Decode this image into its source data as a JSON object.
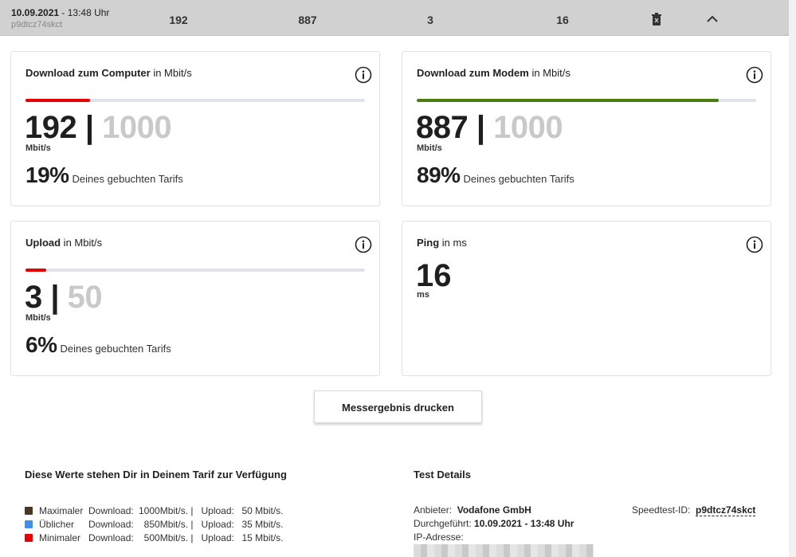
{
  "header": {
    "date": "10.09.2021",
    "time": " - 13:48 Uhr",
    "test_id": "p9dtcz74skct",
    "download_computer": "192",
    "download_modem": "887",
    "upload": "3",
    "ping": "16",
    "icons": [
      "trash-icon",
      "chevron-up-icon"
    ]
  },
  "cards": {
    "download_computer": {
      "title_bold": "Download zum Computer",
      "title_unit": " in Mbit/s",
      "value": "192",
      "separator": " | ",
      "max": "1000",
      "unit": "Mbit/s",
      "percent": "19%",
      "percent_label": "Deines gebuchten Tarifs",
      "progress": 0.19,
      "bar_color": "#e60000"
    },
    "download_modem": {
      "title_bold": "Download zum Modem",
      "title_unit": " in Mbit/s",
      "value": "887",
      "separator": " | ",
      "max": "1000",
      "unit": "Mbit/s",
      "percent": "89%",
      "percent_label": "Deines gebuchten Tarifs",
      "progress": 0.89,
      "bar_color": "#4a7e0f"
    },
    "upload": {
      "title_bold": "Upload",
      "title_unit": " in Mbit/s",
      "value": "3",
      "separator": " | ",
      "max": "50",
      "unit": "Mbit/s",
      "percent": "6%",
      "percent_label": "Deines gebuchten Tarifs",
      "progress": 0.06,
      "bar_color": "#e60000"
    },
    "ping": {
      "title_bold": "Ping",
      "title_unit": " in ms",
      "value": "16",
      "unit": "ms"
    }
  },
  "print_button": "Messergebnis drucken",
  "tarif": {
    "title": "Diese Werte stehen Dir in Deinem Tarif zur Verfügung",
    "rows": [
      {
        "name": "Maximaler",
        "download_label": "Download:",
        "download": "1000Mbit/s. |",
        "upload_label": "Upload:",
        "upload": "50 Mbit/s.",
        "color": "#4a3520"
      },
      {
        "name": "Üblicher",
        "download_label": "Download:",
        "download": "850Mbit/s. |",
        "upload_label": "Upload:",
        "upload": "35 Mbit/s.",
        "color": "#3d8fe8"
      },
      {
        "name": "Minimaler",
        "download_label": "Download:",
        "download": "500Mbit/s. |",
        "upload_label": "Upload:",
        "upload": "15 Mbit/s.",
        "color": "#e60000"
      }
    ]
  },
  "details": {
    "title": "Test Details",
    "provider_label": "Anbieter:",
    "provider": "Vodafone GmbH",
    "performed_label": "Durchgeführt:",
    "performed": "10.09.2021 - 13:48 Uhr",
    "ip_label": "IP-Adresse:",
    "speedtest_label": "Speedtest-ID:",
    "speedtest_id": "p9dtcz74skct"
  }
}
